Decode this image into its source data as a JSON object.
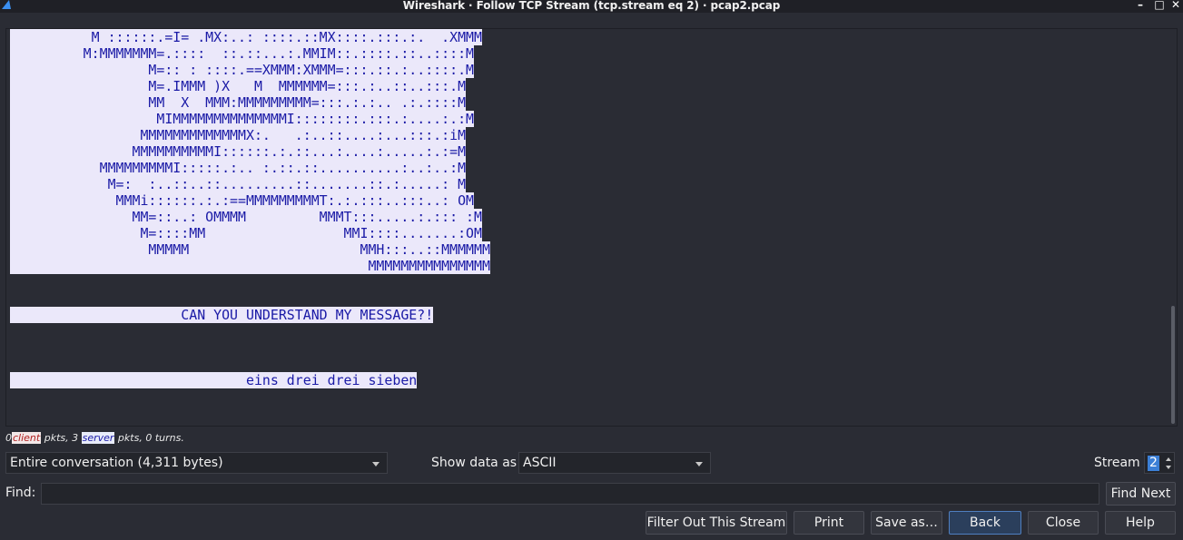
{
  "window": {
    "title": "Wireshark · Follow TCP Stream (tcp.stream eq 2) · pcap2.pcap",
    "minimize": "–",
    "maximize": "□",
    "close": "✕"
  },
  "stream_lines": [
    "          M ::::::.=I= .MX:..: ::::.::MX::::.:::.:.  .XMMM",
    "         M:MMMMMMM=.::::  ::.::...:.MMIM::.::::.::..::::M",
    "                 M=:: : ::::.==XMMM:XMMM=:::.::.:..::::.M",
    "                 M=.IMMM )X   M  MMMMMM=:::.:..::..:::.M",
    "                 MM  X  MMM:MMMMMMMMM=:::.:.:.. .:.::::M",
    "                  MIMMMMMMMMMMMMMMI::::::::.:::.:....:.:M",
    "                MMMMMMMMMMMMMX:.   .:..::....:...:::.:iM",
    "               MMMMMMMMMMI::::::.:.::...:....:.....:.:=M",
    "           MMMMMMMMMI:::::.:.. :.::.::..........:..:..:M",
    "            M=:  :..::..::.........::.......::.:.....: M",
    "             MMMi::::::.:.:==MMMMMMMMMT:.:.:::..:::..: OM",
    "               MM=::..: OMMMM         MMMT:::.....:.::: :M",
    "                M=::::MM                 MMI::::.......:OM",
    "                 MMMMM                     MMH:::..::MMMMMM",
    "                                            MMMMMMMMMMMMMMM",
    "",
    "",
    "                     CAN YOU UNDERSTAND MY MESSAGE?!",
    "",
    "",
    "",
    "                             eins drei drei sieben",
    ""
  ],
  "stats": {
    "client_count": "0",
    "client_label": "client",
    "server_sep": " pkts, 3 ",
    "server_label": "server",
    "tail": " pkts, 0 turns."
  },
  "conversation_select": {
    "value": "Entire conversation (4,311 bytes)"
  },
  "show_data_as": {
    "label": "Show data as",
    "value": "ASCII"
  },
  "stream": {
    "label": "Stream",
    "value": "2"
  },
  "find": {
    "label": "Find:",
    "value": "",
    "find_next_label": "Find Next"
  },
  "buttons": {
    "filter_out": "Filter Out This Stream",
    "print": "Print",
    "save_as": "Save as…",
    "back": "Back",
    "close": "Close",
    "help": "Help"
  },
  "colors": {
    "server_text": "#1a1aa6",
    "server_bg": "#ebe8fa",
    "window_bg": "#2a2c34",
    "accent": "#3b7fd6"
  }
}
